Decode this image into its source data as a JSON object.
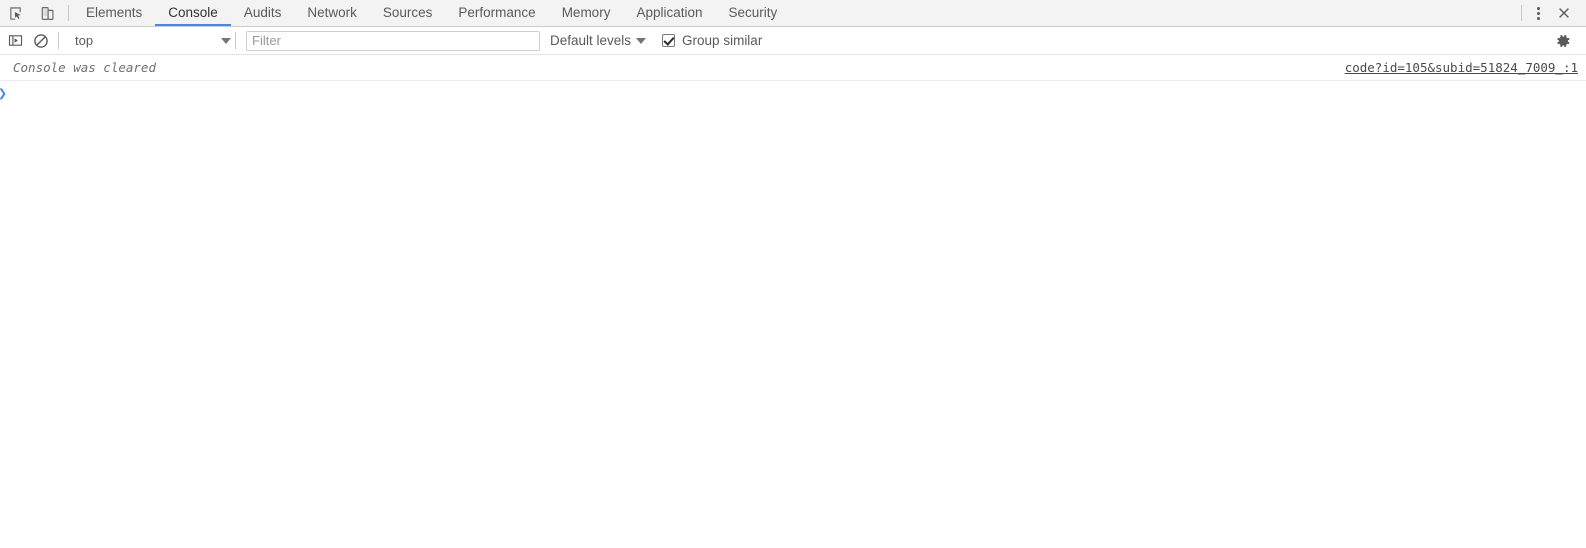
{
  "tabbar": {
    "inspect_icon": "inspect-cursor-icon",
    "device_icon": "device-toolbar-icon",
    "tabs": [
      {
        "label": "Elements",
        "active": false
      },
      {
        "label": "Console",
        "active": true
      },
      {
        "label": "Audits",
        "active": false
      },
      {
        "label": "Network",
        "active": false
      },
      {
        "label": "Sources",
        "active": false
      },
      {
        "label": "Performance",
        "active": false
      },
      {
        "label": "Memory",
        "active": false
      },
      {
        "label": "Application",
        "active": false
      },
      {
        "label": "Security",
        "active": false
      }
    ],
    "more_icon": "more-vertical-icon",
    "close_icon": "close-icon"
  },
  "toolbar": {
    "sidebar_icon": "console-sidebar-icon",
    "clear_icon": "clear-console-icon",
    "context": "top",
    "context_caret_icon": "chevron-down-icon",
    "filter_placeholder": "Filter",
    "filter_value": "",
    "levels_label": "Default levels",
    "levels_caret_icon": "chevron-down-icon",
    "group_similar_label": "Group similar",
    "group_similar_checked": true,
    "settings_icon": "gear-icon"
  },
  "console": {
    "messages": [
      {
        "text": "Console was cleared",
        "source_link": "code?id=105&subid=51824_7009_:1"
      }
    ],
    "prompt_symbol": "❯"
  },
  "colors": {
    "accent": "#4285f4",
    "tabbar_bg": "#f3f3f3",
    "text": "#5a5a5a"
  }
}
